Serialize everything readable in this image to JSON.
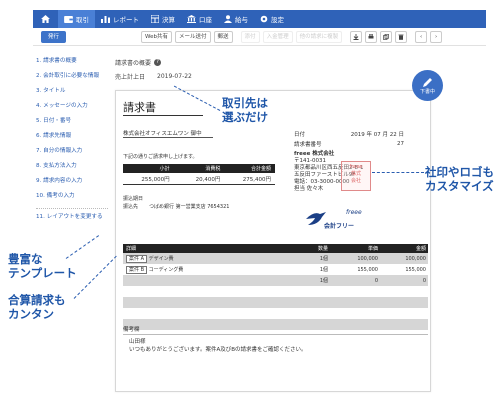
{
  "nav": {
    "items": [
      {
        "id": "home",
        "label": "",
        "icon": "home-icon"
      },
      {
        "id": "torihiki",
        "label": "取引",
        "icon": "wallet-icon"
      },
      {
        "id": "report",
        "label": "レポート",
        "icon": "chart-icon"
      },
      {
        "id": "kessan",
        "label": "決算",
        "icon": "calculator-icon"
      },
      {
        "id": "koza",
        "label": "口座",
        "icon": "bank-icon"
      },
      {
        "id": "jinji",
        "label": "給与",
        "icon": "person-icon"
      },
      {
        "id": "settei",
        "label": "設定",
        "icon": "gear-icon"
      }
    ]
  },
  "toolbar": {
    "execute": "発行",
    "web": "Web共有",
    "mail": "メール送付",
    "mail2": "郵送",
    "dis1": "添付",
    "dis2": "入金管理",
    "dis3": "他の請求に複製",
    "icons": [
      "download-icon",
      "print-icon",
      "copy-icon",
      "trash-icon"
    ],
    "prev": "‹",
    "next": "›"
  },
  "steps": [
    "1. 請求書の概要",
    "2. 会計取引に必要な情報",
    "3. タイトル",
    "4. メッセージの入力",
    "5. 日付・番号",
    "6. 請求先情報",
    "7. 自分の情報入力",
    "8. 支払方法入力",
    "9. 請求内容の入力",
    "10. 備考の入力",
    "11. レイアウトを変更する"
  ],
  "summary_block": {
    "label1": "請求書の概要",
    "help": "?",
    "label2": "売上計上日",
    "date": "2019-07-22"
  },
  "invoice": {
    "title": "請求書",
    "client": "株式会社オフィスエムワン 御中",
    "note": "下記の通りご請求申し上げます。",
    "sum_headers": [
      "小計",
      "消費税",
      "合計金額"
    ],
    "sum_values": [
      "255,000円",
      "20,400円",
      "275,400円"
    ],
    "misc_labels": [
      "振込期日",
      "振込先"
    ],
    "misc_value": "つばめ銀行 第一営業支店 7654321",
    "date_label": "日付",
    "date_value": "2019 年 07 月 22 日",
    "number_label": "請求書番号",
    "number_value": "27",
    "company_lines": [
      "freee 株式会社",
      "〒141-0031",
      "東京都品川区西五反田2-8-1",
      "五反田ファーストビル9F",
      "電話：03-3000-0000",
      "担当 佐々木"
    ],
    "stamp_text": [
      "freee",
      "株式",
      "会社"
    ],
    "logo_text": "会計フリー",
    "logo_mark": "freee",
    "item_headers": [
      "詳細",
      "数量",
      "単価",
      "金額"
    ],
    "items": [
      {
        "tag": "案件 A",
        "name": "デザイン費",
        "qty": "1個",
        "price": "100,000",
        "amount": "100,000"
      },
      {
        "tag": "案件 B",
        "name": "コーディング費",
        "qty": "1個",
        "price": "155,000",
        "amount": "155,000"
      },
      {
        "tag": "",
        "name": "",
        "qty": "1個",
        "price": "0",
        "amount": "0"
      },
      {
        "tag": "",
        "name": "",
        "qty": "",
        "price": "",
        "amount": ""
      },
      {
        "tag": "",
        "name": "",
        "qty": "",
        "price": "",
        "amount": ""
      },
      {
        "tag": "",
        "name": "",
        "qty": "",
        "price": "",
        "amount": ""
      }
    ],
    "remarks_label": "備考欄",
    "remarks_lines": [
      "山田様",
      "いつもありがとうございます。案件A及びBの請求書をご確認ください。"
    ]
  },
  "pen_label": "下書中",
  "callouts": {
    "c1": [
      "取引先は",
      "選ぶだけ"
    ],
    "c2": [
      "社印やロゴも",
      "カスタマイズ"
    ],
    "c3": [
      "豊富な",
      "テンプレート"
    ],
    "c4": [
      "合算請求も",
      "カンタン"
    ]
  }
}
